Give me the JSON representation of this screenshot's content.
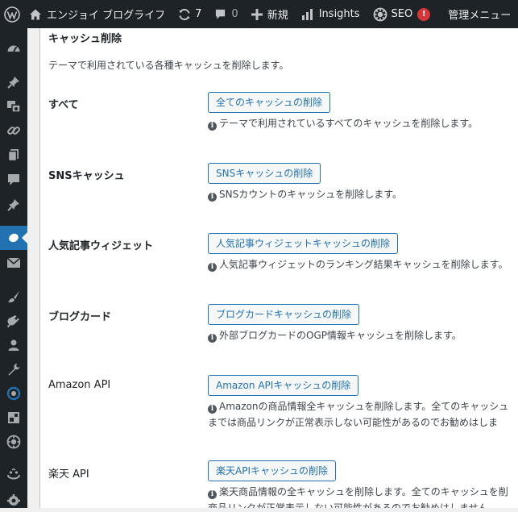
{
  "admin_bar": {
    "site_name": "エンジョイ ブログライフ",
    "updates_count": "7",
    "comments_count": "0",
    "new_label": "新規",
    "insights_label": "Insights",
    "seo_label": "SEO",
    "seo_badge": "!",
    "admin_menu_label": "管理メニュー"
  },
  "sidebar": {
    "icons": [
      "dashboard-icon",
      "pin-icon",
      "media-icon",
      "links-icon",
      "pages-icon",
      "comments-icon",
      "pin-icon-2",
      "cocoon-icon",
      "mail-icon",
      "appearance-icon",
      "plugins-icon",
      "users-icon",
      "tools-icon",
      "insights-icon",
      "blocks-icon",
      "seo-icon",
      "smile-icon",
      "settings-icon"
    ],
    "current": "cocoon-icon"
  },
  "section": {
    "title": "キャッシュ削除",
    "description": "テーマで利用されている各種キャッシュを削除します。"
  },
  "rows": [
    {
      "label": "すべて",
      "button": "全てのキャッシュの削除",
      "note_line1": "テーマで利用されているすべてのキャッシュを削除します。",
      "note_line2": ""
    },
    {
      "label": "SNSキャッシュ",
      "button": "SNSキャッシュの削除",
      "note_line1": "SNSカウントのキャッシュを削除します。",
      "note_line2": ""
    },
    {
      "label": "人気記事ウィジェット",
      "button": "人気記事ウィジェットキャッシュの削除",
      "note_line1": "人気記事ウィジェットのランキング結果キャッシュを削除します。",
      "note_line2": ""
    },
    {
      "label": "ブログカード",
      "button": "ブログカードキャッシュの削除",
      "note_line1": "外部ブログカードのOGP情報キャッシュを削除します。",
      "note_line2": ""
    },
    {
      "label": "Amazon API",
      "button": "Amazon APIキャッシュの削除",
      "note_line1": "Amazonの商品情報全キャッシュを削除します。全てのキャッシュ",
      "note_line2": "までは商品リンクが正常表示しない可能性があるのでお勧めはしま"
    },
    {
      "label": "楽天 API",
      "button": "楽天APIキャッシュの削除",
      "note_line1": "楽天商品情報の全キャッシュを削除します。全てのキャッシュを削",
      "note_line2": "商品リンクが正常表示しない可能性があるのでお勧めはしません。"
    }
  ],
  "colors": {
    "admin_bar_bg": "#1d2327",
    "accent": "#2271b1",
    "badge_red": "#d63638"
  }
}
